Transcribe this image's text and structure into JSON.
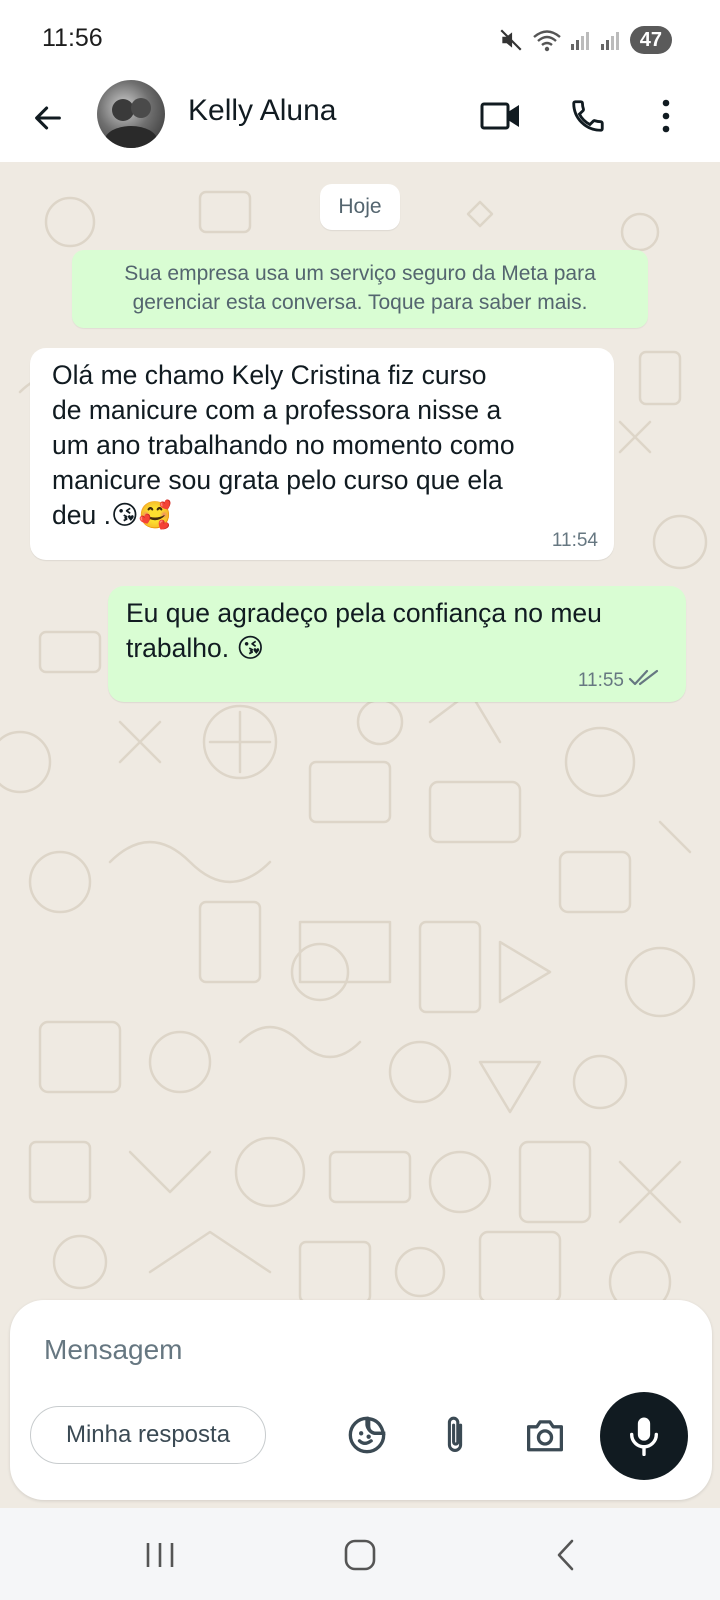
{
  "status_bar": {
    "time": "11:56",
    "battery": "47"
  },
  "header": {
    "contact_name": "Kelly Aluna",
    "icons": [
      "back-arrow-icon",
      "video-call-icon",
      "phone-icon",
      "more-vert-icon"
    ]
  },
  "chat": {
    "date_chip": "Hoje",
    "system_message": "Sua empresa usa um serviço seguro da Meta para gerenciar esta conversa. Toque para saber mais.",
    "messages": [
      {
        "direction": "incoming",
        "text": "Olá me chamo Kely Cristina fiz curso\nde manicure com a professora nisse a\num ano trabalhando no momento como\nmanicure sou grata pelo curso que ela\ndeu .😘🥰",
        "time": "11:54"
      },
      {
        "direction": "outgoing",
        "text": "Eu que agradeço pela confiança no meu\ntrabalho. 😘",
        "time": "11:55",
        "status": "read"
      }
    ],
    "colors": {
      "background": "#efeae2",
      "incoming_bubble": "#ffffff",
      "outgoing_bubble": "#d9fdd3",
      "read_ticks": "#667781"
    }
  },
  "composer": {
    "placeholder": "Mensagem",
    "quick_reply": "Minha resposta",
    "icons": [
      "sticker-icon",
      "attach-icon",
      "camera-icon",
      "mic-icon"
    ]
  },
  "nav_bar": {
    "icons": [
      "recent-apps-icon",
      "home-icon",
      "back-icon"
    ]
  }
}
